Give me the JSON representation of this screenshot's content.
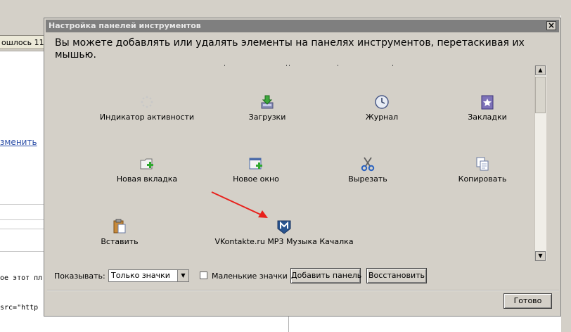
{
  "background": {
    "tab_label": "ошлось 11...",
    "link_text": "зменить",
    "code_line_1": "ое этот пл",
    "code_line_2": "src=\"http"
  },
  "dialog": {
    "title": "Настройка панелей инструментов",
    "close_glyph": "×",
    "instructions": "Вы можете добавлять или удалять элементы на панелях инструментов, перетаскивая их мышью.",
    "items": [
      {
        "label": "Индикатор активности",
        "icon": "throbber-icon"
      },
      {
        "label": "Загрузки",
        "icon": "downloads-icon"
      },
      {
        "label": "Журнал",
        "icon": "history-clock-icon"
      },
      {
        "label": "Закладки",
        "icon": "bookmarks-star-icon"
      },
      {
        "label": "Новая вкладка",
        "icon": "new-tab-icon"
      },
      {
        "label": "Новое окно",
        "icon": "new-window-icon"
      },
      {
        "label": "Вырезать",
        "icon": "scissors-icon"
      },
      {
        "label": "Копировать",
        "icon": "copy-icon"
      },
      {
        "label": "Вставить",
        "icon": "paste-clipboard-icon"
      },
      {
        "label": "VKontakte.ru MP3 Музыка Качалка",
        "icon": "vkontakte-m-icon"
      }
    ],
    "show_label": "Показывать:",
    "show_select_value": "Только значки",
    "small_icons_label": "Маленькие значки",
    "small_icons_checked": false,
    "add_panel_button": "Добавить панель",
    "restore_button": "Восстановить",
    "done_button": "Готово",
    "colors": {
      "dialog_bg": "#d4d0c8",
      "titlebar_bg": "#7f7f7f",
      "arrow": "#e8201b"
    }
  }
}
